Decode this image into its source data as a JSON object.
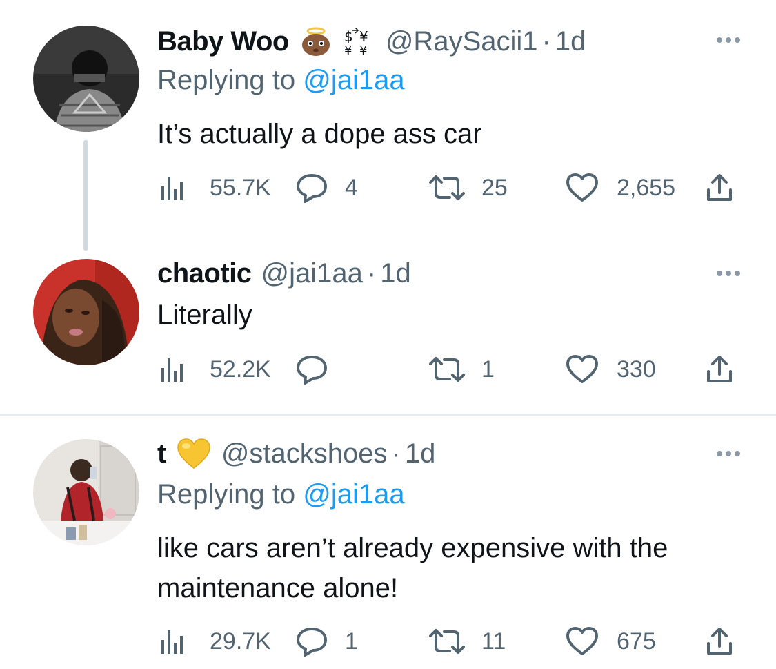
{
  "tweets": [
    {
      "name": "Baby Woo",
      "emoji_icons": [
        "angel-baby-emoji-icon",
        "currency-exchange-emoji-icon"
      ],
      "handle": "@RaySacii1",
      "dot": "·",
      "time": "1d",
      "replying_prefix": "Replying to",
      "replying_to": "@jai1aa",
      "text": "It’s actually a dope ass car",
      "views": "55.7K",
      "replies": "4",
      "retweets": "25",
      "likes": "2,655"
    },
    {
      "name": "chaotic",
      "handle": "@jai1aa",
      "dot": "·",
      "time": "1d",
      "text": "Literally",
      "views": "52.2K",
      "replies": "",
      "retweets": "1",
      "likes": "330"
    },
    {
      "name": "t",
      "emoji_icons": [
        "yellow-heart-emoji-icon"
      ],
      "handle": "@stackshoes",
      "dot": "·",
      "time": "1d",
      "replying_prefix": "Replying to",
      "replying_to": "@jai1aa",
      "text": "like cars aren’t already expensive with the maintenance alone!",
      "views": "29.7K",
      "replies": "1",
      "retweets": "11",
      "likes": "675"
    }
  ],
  "colors": {
    "text": "#0f1419",
    "muted": "#536471",
    "link": "#1d9bf0",
    "thread_line": "#cfd9de",
    "divider": "#e6ecf0"
  }
}
